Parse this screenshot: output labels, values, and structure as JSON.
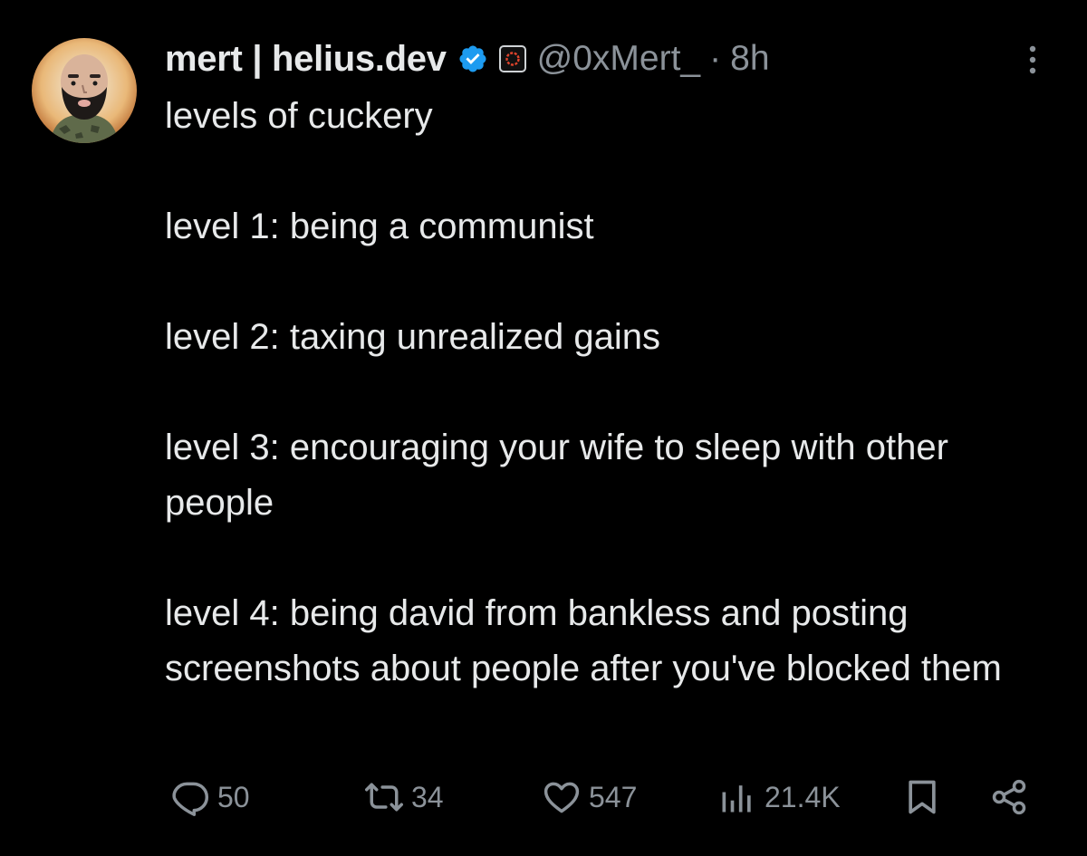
{
  "tweet": {
    "display_name": "mert | helius.dev",
    "handle": "@0xMert_",
    "separator": "·",
    "time": "8h",
    "paragraphs": [
      "levels of cuckery",
      "level 1: being a communist",
      "level 2: taxing unrealized gains",
      "level 3: encouraging your wife to sleep with other people",
      "level 4: being david from bankless and posting screenshots about people after you've blocked them"
    ]
  },
  "actions": {
    "replies": "50",
    "retweets": "34",
    "likes": "547",
    "views": "21.4K"
  },
  "icons": {
    "avatar": "avatar-image",
    "verified": "verified-badge-icon",
    "affiliate": "affiliate-badge-icon",
    "more": "more-options-icon",
    "reply": "reply-icon",
    "retweet": "retweet-icon",
    "like": "heart-icon",
    "views": "views-chart-icon",
    "bookmark": "bookmark-icon",
    "share": "share-icon"
  },
  "colors": {
    "background": "#000000",
    "text": "#e7e9ea",
    "muted": "#8b9299",
    "verified_blue": "#1d9bf0"
  }
}
